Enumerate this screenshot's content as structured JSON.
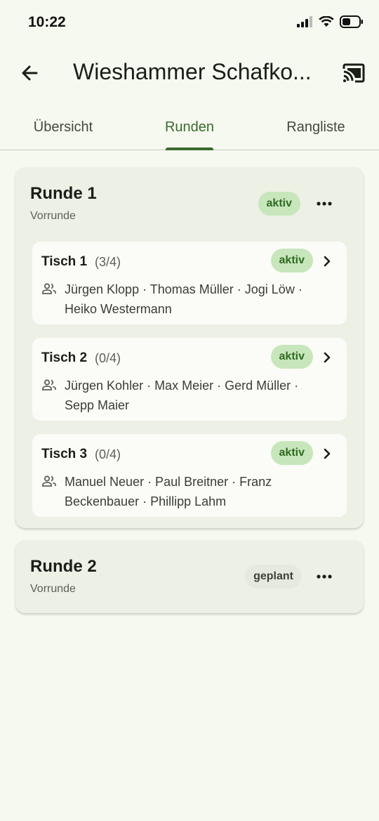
{
  "status_bar": {
    "time": "10:22"
  },
  "app_bar": {
    "title": "Wieshammer Schafko..."
  },
  "tabs": [
    {
      "label": "Übersicht"
    },
    {
      "label": "Runden",
      "selected": true
    },
    {
      "label": "Rangliste"
    }
  ],
  "rounds": [
    {
      "title": "Runde 1",
      "subtitle": "Vorrunde",
      "status": "aktiv",
      "tables": [
        {
          "name": "Tisch 1",
          "count": "(3/4)",
          "status": "aktiv",
          "players": "Jürgen Klopp · Thomas Müller · Jogi Löw · Heiko Westermann"
        },
        {
          "name": "Tisch 2",
          "count": "(0/4)",
          "status": "aktiv",
          "players": "Jürgen Kohler · Max Meier · Gerd Müller · Sepp Maier"
        },
        {
          "name": "Tisch 3",
          "count": "(0/4)",
          "status": "aktiv",
          "players": "Manuel Neuer · Paul Breitner · Franz Beckenbauer · Phillipp Lahm"
        }
      ]
    },
    {
      "title": "Runde 2",
      "subtitle": "Vorrunde",
      "status": "geplant"
    }
  ],
  "colors": {
    "accent": "#3a6a2f",
    "chip_active_bg": "#c7e6bc",
    "background": "#f6f9ef"
  }
}
